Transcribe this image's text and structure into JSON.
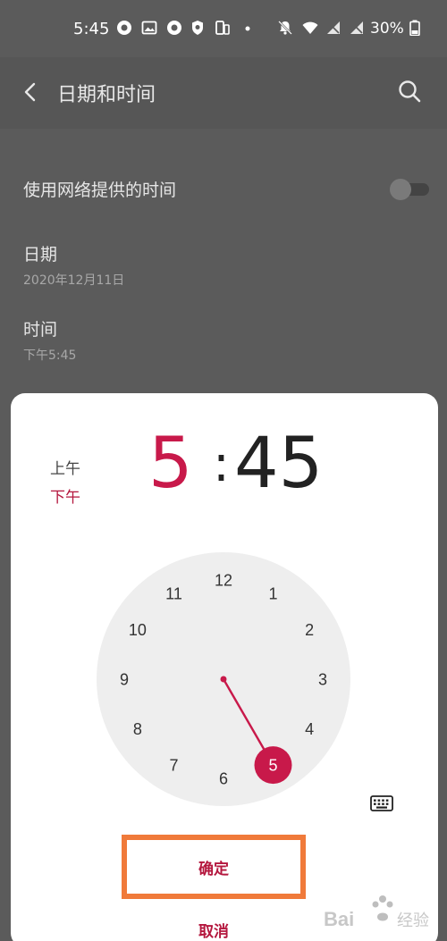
{
  "status_bar": {
    "time": "5:45",
    "battery": "30%",
    "icons": [
      "whatsapp-icon",
      "gallery-icon",
      "whatsapp-icon",
      "shield-icon",
      "phone-link-icon",
      "dot-icon",
      "mute-icon",
      "wifi-icon",
      "no-sim-icon",
      "no-sim-icon",
      "battery-icon"
    ]
  },
  "header": {
    "title": "日期和时间",
    "back_icon": "back-arrow-icon",
    "search_icon": "search-icon"
  },
  "settings": {
    "network_time": {
      "label": "使用网络提供的时间",
      "enabled": false
    },
    "date": {
      "label": "日期",
      "value": "2020年12月11日"
    },
    "time": {
      "label": "时间",
      "value": "下午5:45"
    }
  },
  "time_picker": {
    "am_label": "上午",
    "pm_label": "下午",
    "selected_period": "下午",
    "hour": "5",
    "separator": ":",
    "minute": "45",
    "clock_numbers": [
      "12",
      "1",
      "2",
      "3",
      "4",
      "5",
      "6",
      "7",
      "8",
      "9",
      "10",
      "11"
    ],
    "selected_hour": "5",
    "confirm_label": "确定",
    "cancel_label": "取消",
    "keyboard_icon": "keyboard-icon"
  },
  "colors": {
    "accent": "#c8194a",
    "highlight_border": "#f07a3a",
    "clock_face": "#eeeeee"
  }
}
